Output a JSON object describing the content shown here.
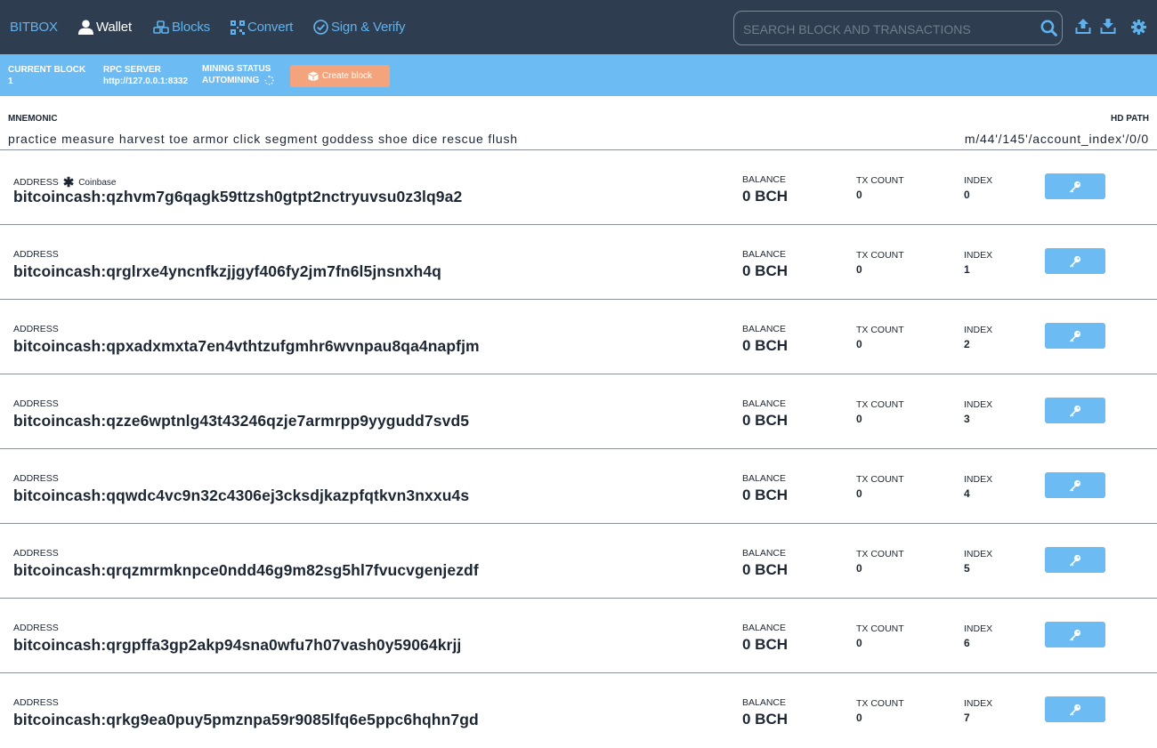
{
  "nav": {
    "brand": "BITBOX",
    "items": [
      {
        "label": "Wallet",
        "icon": "user-icon",
        "active": true
      },
      {
        "label": "Blocks",
        "icon": "cubes-icon",
        "active": false
      },
      {
        "label": "Convert",
        "icon": "qrcode-icon",
        "active": false
      },
      {
        "label": "Sign & Verify",
        "icon": "check-circle-icon",
        "active": false
      }
    ],
    "search_placeholder": "SEARCH BLOCK AND TRANSACTIONS",
    "tools": [
      "upload-icon",
      "download-icon",
      "gear-icon"
    ]
  },
  "status": {
    "current_block_label": "CURRENT BLOCK",
    "current_block": "1",
    "rpc_label": "RPC SERVER",
    "rpc": "http://127.0.0.1:8332",
    "mining_label": "MINING STATUS",
    "mining": "AUTOMINING",
    "create_block": "Create block"
  },
  "wallet": {
    "mnemonic_label": "MNEMONIC",
    "mnemonic": "practice measure harvest toe armor click segment goddess shoe dice rescue flush",
    "hd_label": "HD PATH",
    "hd_path": "m/44'/145'/account_index'/0/0"
  },
  "labels": {
    "address": "ADDRESS",
    "coinbase": "Coinbase",
    "balance": "BALANCE",
    "tx_count": "TX COUNT",
    "index": "INDEX"
  },
  "addresses": [
    {
      "address": "bitcoincash:qzhvm7g6qagk59ttzsh0gtpt2nctryuvsu0z3lq9a2",
      "balance": "0 BCH",
      "tx_count": "0",
      "index": "0"
    },
    {
      "address": "bitcoincash:qrglrxe4yncnfkzjjgyf406fy2jm7fn6l5jnsnxh4q",
      "balance": "0 BCH",
      "tx_count": "0",
      "index": "1"
    },
    {
      "address": "bitcoincash:qpxadxmxta7en4vthtzufgmhr6wvnpau8qa4napfjm",
      "balance": "0 BCH",
      "tx_count": "0",
      "index": "2"
    },
    {
      "address": "bitcoincash:qzze6wptnlg43t43246qzje7armrpp9yygudd7svd5",
      "balance": "0 BCH",
      "tx_count": "0",
      "index": "3"
    },
    {
      "address": "bitcoincash:qqwdc4vc9n32c4306ej3cksdjkazpfqtkvn3nxxu4s",
      "balance": "0 BCH",
      "tx_count": "0",
      "index": "4"
    },
    {
      "address": "bitcoincash:qrqzmrmknpce0ndd46g9m82sg5hl7fvucvgenjezdf",
      "balance": "0 BCH",
      "tx_count": "0",
      "index": "5"
    },
    {
      "address": "bitcoincash:qrgpffa3gp2akp94sna0wfu7h07vash0y59064krjj",
      "balance": "0 BCH",
      "tx_count": "0",
      "index": "6"
    },
    {
      "address": "bitcoincash:qrkg9ea0puy5pmznpa59r9085lfq6e5ppc6hqhn7gd",
      "balance": "0 BCH",
      "tx_count": "0",
      "index": "7"
    }
  ],
  "colors": {
    "navbar": "#2e3d50",
    "accent": "#6cbbf2",
    "create_button": "#f4a47c"
  }
}
